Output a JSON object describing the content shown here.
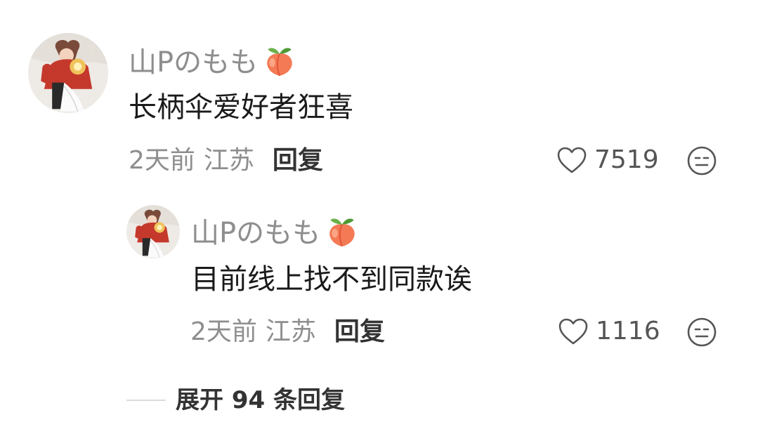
{
  "comment": {
    "username": "山Pのもも",
    "username_emoji": "peach-emoji",
    "text": "长柄伞爱好者狂喜",
    "time": "2天前",
    "location": "江苏",
    "reply_label": "回复",
    "like_count": "7519",
    "like_icon": "heart-outline-icon",
    "dislike_icon": "neutral-face-icon"
  },
  "reply": {
    "username": "山Pのもも",
    "username_emoji": "peach-emoji",
    "text": "目前线上找不到同款诶",
    "time": "2天前",
    "location": "江苏",
    "reply_label": "回复",
    "like_count": "1116",
    "like_icon": "heart-outline-icon",
    "dislike_icon": "neutral-face-icon"
  },
  "expand_label": "展开 94 条回复",
  "colors": {
    "username": "#8e8e8e",
    "text": "#1a1a1a",
    "meta": "#8e8e8e",
    "peach": "#f47a55"
  }
}
